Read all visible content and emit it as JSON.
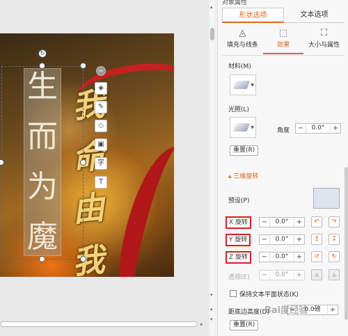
{
  "canvas": {
    "vertical_text": [
      "生",
      "而",
      "为",
      "魔"
    ],
    "calligraphy": [
      "我",
      "命",
      "由",
      "我"
    ],
    "float_toolbar": [
      {
        "icon": "minus-circle-icon",
        "glyph": "−"
      },
      {
        "icon": "layers-icon",
        "glyph": "◈"
      },
      {
        "icon": "pen-icon",
        "glyph": "✎"
      },
      {
        "icon": "fill-icon",
        "glyph": "◇"
      },
      {
        "icon": "border-icon",
        "glyph": "▣"
      },
      {
        "icon": "font-icon",
        "glyph": "字"
      },
      {
        "icon": "textbox-icon",
        "glyph": "T"
      }
    ]
  },
  "panel": {
    "title": "对象属性",
    "tabs": [
      {
        "label": "形状选项",
        "active": true
      },
      {
        "label": "文本选项",
        "active": false
      }
    ],
    "subtabs": [
      {
        "label": "填充与线条",
        "icon": "paint-bucket-icon",
        "glyph": "◬"
      },
      {
        "label": "效果",
        "icon": "effects-icon",
        "glyph": "⬚",
        "active": true
      },
      {
        "label": "大小与属性",
        "icon": "size-icon",
        "glyph": "⛶"
      }
    ],
    "material_label": "材料(M)",
    "lighting_label": "光照(L)",
    "angle_label": "角度",
    "angle_value": "0.0°",
    "reset_label": "重置(R)",
    "section_3d": "三维旋转",
    "preset_label": "预设(P)",
    "x_label": "X 旋转",
    "x_value": "0.0°",
    "y_label": "Y 旋转",
    "y_value": "0.0°",
    "z_label": "Z 旋转",
    "z_value": "0.0°",
    "perspective_label": "透视(E)",
    "perspective_value": "0.0°",
    "keep_flat_label": "保持文本平面状态(K)",
    "distance_label": "距底边高度(D)",
    "distance_value": "0.0磅",
    "reset2_label": "重置(R)",
    "minus": "−",
    "plus": "+"
  },
  "watermark": "Bai度经验"
}
